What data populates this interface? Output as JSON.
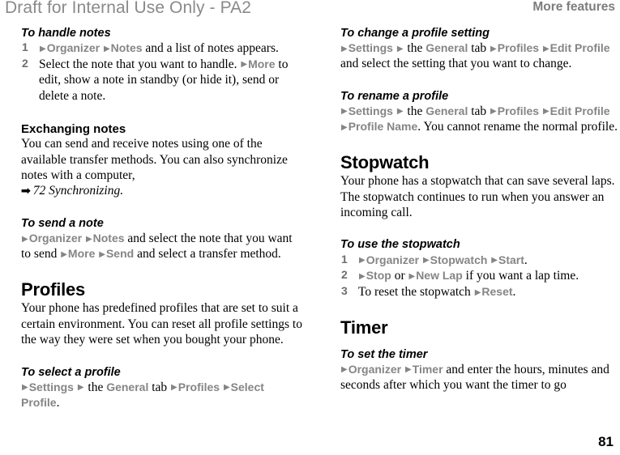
{
  "watermark": "Draft for Internal Use Only - PA2",
  "running_head": "More features",
  "folio": "81",
  "colors": {
    "menu_gray": "#858585",
    "watermark_gray": "#8a8a8a",
    "running_head_gray": "#7d7d7d",
    "step_number_gray": "#6e6e6e",
    "text_black": "#000000"
  },
  "icons": {
    "menu_arrow": "▶",
    "xref_arrow": "➡"
  },
  "left_column": {
    "handle_notes": {
      "heading": "To handle notes",
      "step1": {
        "number": "1",
        "m1": "Organizer",
        "m2": "Notes",
        "tail": " and a list of notes appears."
      },
      "step2": {
        "number": "2",
        "lead": "Select the note that you want to handle.",
        "m1": "More",
        "tail": " to edit, show a note in standby (or hide it), send or delete a note."
      }
    },
    "exchanging_notes": {
      "heading": "Exchanging notes",
      "body": "You can send and receive notes using one of the available transfer methods. You can also synchronize notes with a computer,",
      "xref": "72 Synchronizing."
    },
    "send_note": {
      "heading": "To send a note",
      "m1": "Organizer",
      "m2": "Notes",
      "mid": " and select the note that you want to send ",
      "m3": "More",
      "m4": "Send",
      "tail": " and select a transfer method."
    },
    "profiles": {
      "heading": "Profiles",
      "body": "Your phone has predefined profiles that are set to suit a certain environment. You can reset all profile settings to the way they were set when you bought your phone."
    },
    "select_profile": {
      "heading": "To select a profile",
      "m1": "Settings",
      "mid1": " the ",
      "m2": "General",
      "mid2": " tab ",
      "m3": "Profiles",
      "m4": "Select Profile",
      "tail": "."
    }
  },
  "right_column": {
    "change_profile_setting": {
      "heading": "To change a profile setting",
      "m1": "Settings",
      "mid1": " the ",
      "m2": "General",
      "mid2": " tab ",
      "m3": "Profiles",
      "m4": "Edit Profile",
      "tail": " and select the setting that you want to change."
    },
    "rename_profile": {
      "heading": "To rename a profile",
      "m1": "Settings",
      "mid1": " the ",
      "m2": "General",
      "mid2": " tab ",
      "m3": "Profiles",
      "m4": "Edit Profile",
      "m5": "Profile Name",
      "tail": ". You cannot rename the normal profile."
    },
    "stopwatch": {
      "heading": "Stopwatch",
      "body": "Your phone has a stopwatch that can save several laps. The stopwatch continues to run when you answer an incoming call."
    },
    "use_stopwatch": {
      "heading": "To use the stopwatch",
      "step1": {
        "number": "1",
        "m1": "Organizer",
        "m2": "Stopwatch",
        "m3": "Start",
        "tail": "."
      },
      "step2": {
        "number": "2",
        "m1": "Stop",
        "mid": " or ",
        "m2": "New Lap",
        "tail": " if you want a lap time."
      },
      "step3": {
        "number": "3",
        "lead": "To reset the stopwatch ",
        "m1": "Reset",
        "tail": "."
      }
    },
    "timer": {
      "heading": "Timer"
    },
    "set_timer": {
      "heading": "To set the timer",
      "m1": "Organizer",
      "m2": "Timer",
      "tail": " and enter the hours, minutes and seconds after which you want the timer to go"
    }
  }
}
